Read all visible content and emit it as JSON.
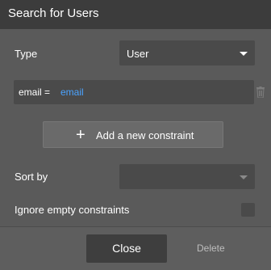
{
  "window": {
    "title": "Search for Users"
  },
  "type_row": {
    "label": "Type",
    "value": "User"
  },
  "constraint": {
    "key": "email =",
    "value": "email"
  },
  "add_constraint": {
    "label": "Add a new constraint",
    "plus": "+"
  },
  "sort_row": {
    "label": "Sort by",
    "value": ""
  },
  "ignore_row": {
    "label": "Ignore empty constraints",
    "checked": false
  },
  "footer": {
    "close_label": "Close",
    "delete_label": "Delete"
  },
  "icons": {
    "dropdown": "chevron-down-icon",
    "trash": "trash-icon",
    "add": "plus-icon"
  },
  "colors": {
    "accent_link": "#4aa3ff",
    "title_bg": "#3c3c3c",
    "panel_bg": "#5a5a5a",
    "field_bg": "#4a4a4a"
  }
}
